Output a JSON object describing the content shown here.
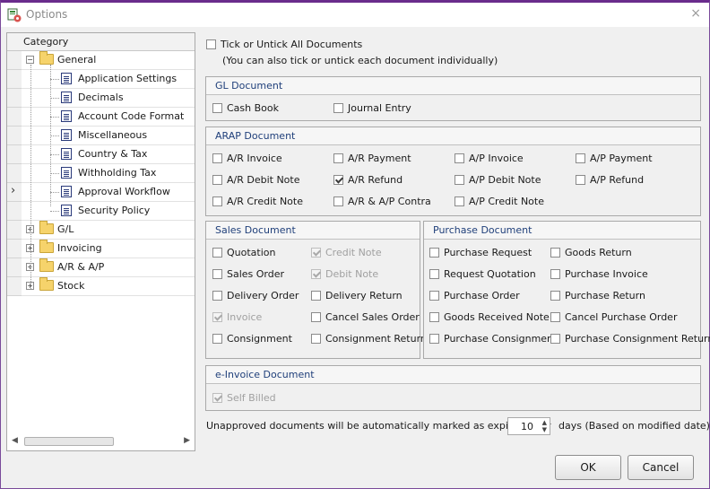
{
  "window": {
    "title": "Options",
    "close_glyph": "×"
  },
  "tree": {
    "header": "Category",
    "items": [
      {
        "label": "General",
        "expander": "−"
      },
      {
        "label": "Application Settings"
      },
      {
        "label": "Decimals"
      },
      {
        "label": "Account Code Format"
      },
      {
        "label": "Miscellaneous"
      },
      {
        "label": "Country & Tax"
      },
      {
        "label": "Withholding Tax"
      },
      {
        "label": "Approval Workflow"
      },
      {
        "label": "Security Policy"
      },
      {
        "label": "G/L",
        "expander": "+"
      },
      {
        "label": "Invoicing",
        "expander": "+"
      },
      {
        "label": "A/R & A/P",
        "expander": "+"
      },
      {
        "label": "Stock",
        "expander": "+"
      }
    ],
    "row_indicator": "›",
    "scroll_left": "◀",
    "scroll_right": "▶"
  },
  "tick_all": {
    "label": "Tick or Untick All Documents",
    "note": "(You can also tick or untick each document individually)",
    "checked": false
  },
  "gl": {
    "title": "GL Document",
    "items": [
      {
        "label": "Cash Book",
        "checked": false
      },
      {
        "label": "Journal Entry",
        "checked": false
      }
    ]
  },
  "arap": {
    "title": "ARAP Document",
    "items": [
      {
        "label": "A/R Invoice",
        "checked": false
      },
      {
        "label": "A/R Payment",
        "checked": false
      },
      {
        "label": "A/P Invoice",
        "checked": false
      },
      {
        "label": "A/P Payment",
        "checked": false
      },
      {
        "label": "A/R Debit Note",
        "checked": false
      },
      {
        "label": "A/R Refund",
        "checked": true
      },
      {
        "label": "A/P Debit Note",
        "checked": false
      },
      {
        "label": "A/P Refund",
        "checked": false
      },
      {
        "label": "A/R Credit Note",
        "checked": false
      },
      {
        "label": "A/R & A/P Contra",
        "checked": false
      },
      {
        "label": "A/P Credit Note",
        "checked": false
      }
    ]
  },
  "sales": {
    "title": "Sales Document",
    "items": [
      {
        "label": "Quotation",
        "checked": false,
        "disabled": false
      },
      {
        "label": "Credit Note",
        "checked": true,
        "disabled": true
      },
      {
        "label": "Sales Order",
        "checked": false,
        "disabled": false
      },
      {
        "label": "Debit Note",
        "checked": true,
        "disabled": true
      },
      {
        "label": "Delivery Order",
        "checked": false,
        "disabled": false
      },
      {
        "label": "Delivery Return",
        "checked": false,
        "disabled": false
      },
      {
        "label": "Invoice",
        "checked": true,
        "disabled": true
      },
      {
        "label": "Cancel Sales Order",
        "checked": false,
        "disabled": false
      },
      {
        "label": "Consignment",
        "checked": false,
        "disabled": false
      },
      {
        "label": "Consignment Return",
        "checked": false,
        "disabled": false
      }
    ]
  },
  "purchase": {
    "title": "Purchase Document",
    "items": [
      {
        "label": "Purchase Request",
        "checked": false
      },
      {
        "label": "Goods Return",
        "checked": false
      },
      {
        "label": "Request Quotation",
        "checked": false
      },
      {
        "label": "Purchase Invoice",
        "checked": false
      },
      {
        "label": "Purchase Order",
        "checked": false
      },
      {
        "label": "Purchase Return",
        "checked": false
      },
      {
        "label": "Goods Received Note",
        "checked": false
      },
      {
        "label": "Cancel Purchase Order",
        "checked": false
      },
      {
        "label": "Purchase Consignment",
        "checked": false
      },
      {
        "label": "Purchase Consignment Return",
        "checked": false
      }
    ]
  },
  "einvoice": {
    "title": "e-Invoice Document",
    "items": [
      {
        "label": "Self Billed",
        "checked": true,
        "disabled": true
      }
    ]
  },
  "expiry": {
    "prefix": "Unapproved documents will be automatically marked as expired after",
    "value": "10",
    "suffix": "days (Based on modified date)",
    "up": "▲",
    "down": "▼"
  },
  "buttons": {
    "ok": "OK",
    "cancel": "Cancel"
  }
}
